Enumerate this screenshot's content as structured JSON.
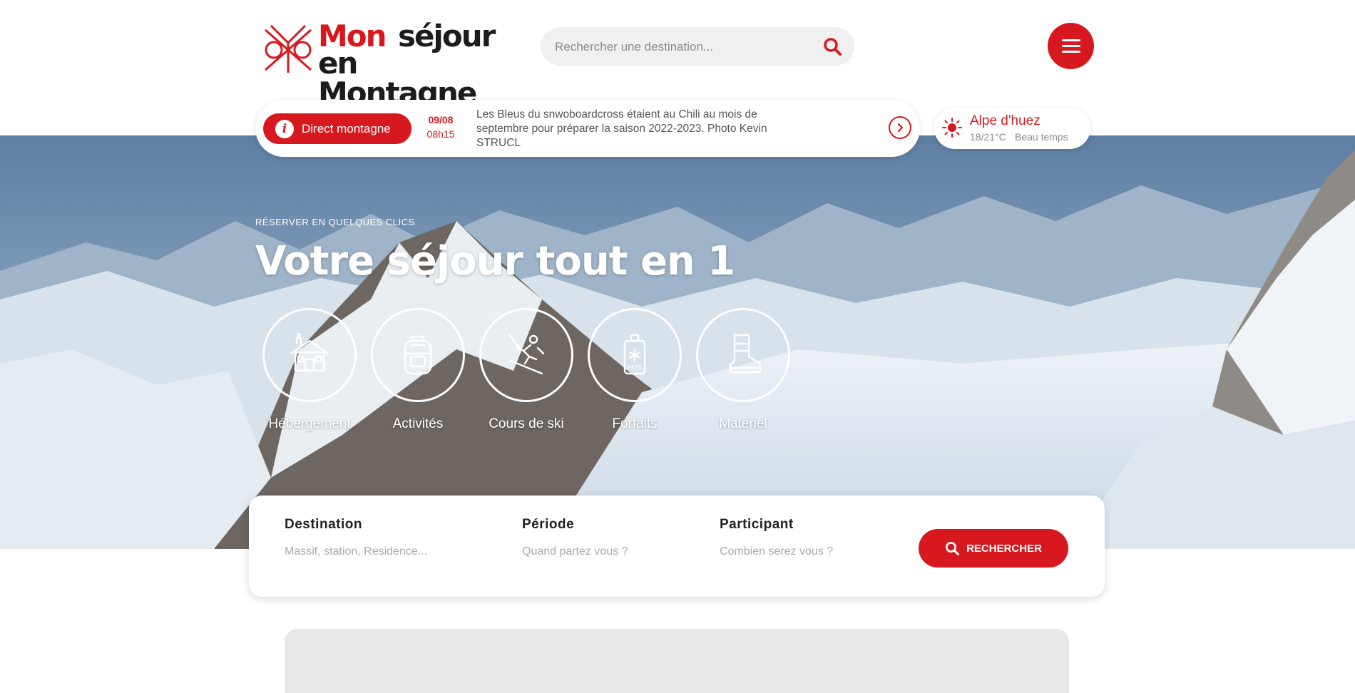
{
  "header": {
    "logo": {
      "line1_red": "Mon",
      "line1_dark": "séjour",
      "line2": "en Montagne"
    },
    "search": {
      "placeholder": "Rechercher une destination...",
      "icon": "search-icon"
    },
    "menu_icon": "hamburger-menu-icon"
  },
  "ticker": {
    "label": "Direct montagne",
    "date": "09/08",
    "time": "08h15",
    "text": "Les Bleus du snwoboardcross étaient au Chili au mois de septembre pour préparer la saison 2022-2023. Photo Kevin STRUCL",
    "next_icon": "chevron-right-icon"
  },
  "weather": {
    "place": "Alpe d'huez",
    "temp": "18/21°C",
    "condition": "Beau temps",
    "icon": "sun-icon"
  },
  "hero": {
    "kicker": "RÉSERVER EN QUELQUES CLICS",
    "title": "Votre séjour tout en 1",
    "categories": [
      {
        "label": "Hébergement",
        "icon": "chalet-icon"
      },
      {
        "label": "Activités",
        "icon": "backpack-icon"
      },
      {
        "label": "Cours de ski",
        "icon": "skier-icon"
      },
      {
        "label": "Forfaits",
        "icon": "ski-pass-icon"
      },
      {
        "label": "Matériel",
        "icon": "ski-boot-icon"
      }
    ]
  },
  "booking": {
    "destination": {
      "label": "Destination",
      "placeholder": "Massif, station, Residence..."
    },
    "period": {
      "label": "Période",
      "placeholder": "Quand partez vous ?"
    },
    "participants": {
      "label": "Participant",
      "placeholder": "Combien serez vous ?"
    },
    "search_button": "RECHERCHER"
  },
  "colors": {
    "brand_red": "#d7191f",
    "dark": "#1c1c1c"
  }
}
